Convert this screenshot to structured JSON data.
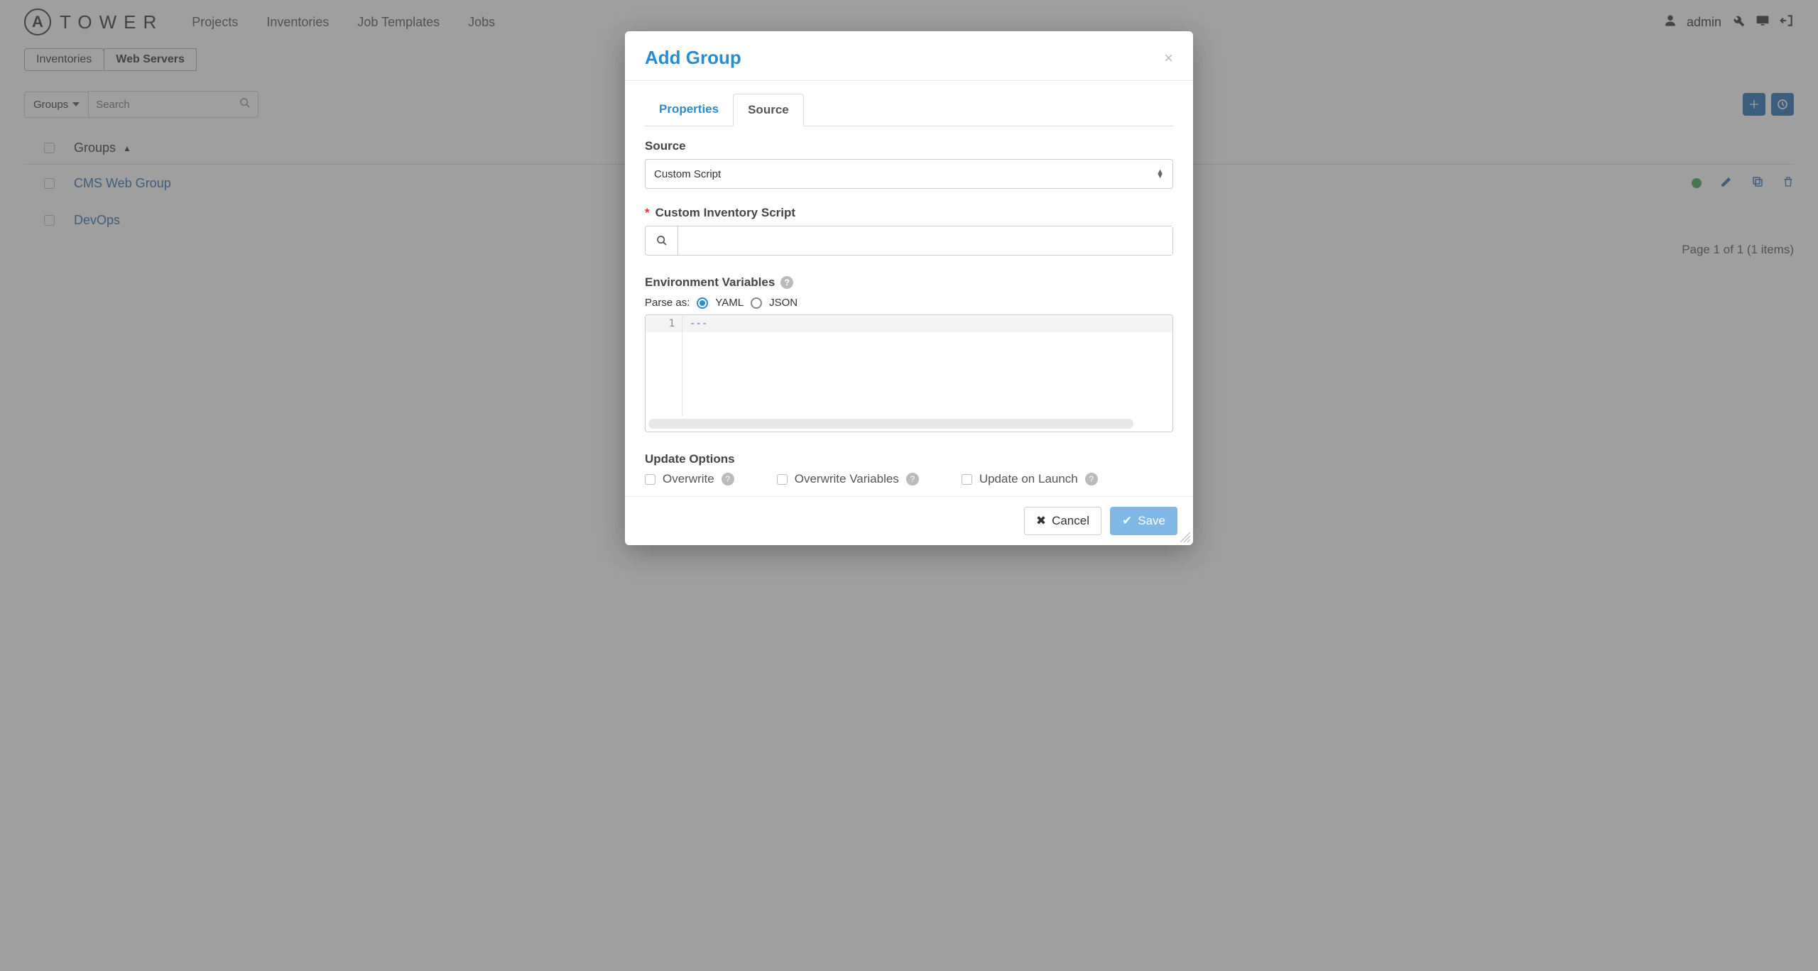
{
  "logo": {
    "badge": "A",
    "text": "TOWER"
  },
  "nav": {
    "projects": "Projects",
    "inventories": "Inventories",
    "job_templates": "Job Templates",
    "jobs": "Jobs"
  },
  "user": {
    "name": "admin"
  },
  "breadcrumb": {
    "a": "Inventories",
    "b": "Web Servers"
  },
  "toolbar": {
    "groups_btn": "Groups",
    "search_placeholder": "Search"
  },
  "table": {
    "header": "Groups",
    "rows": [
      {
        "name": "CMS Web Group"
      },
      {
        "name": "DevOps"
      }
    ],
    "pager": "Page 1 of 1 (1 items)"
  },
  "modal": {
    "title": "Add Group",
    "tabs": {
      "properties": "Properties",
      "source": "Source"
    },
    "source_label": "Source",
    "source_value": "Custom Script",
    "custom_script_label": "Custom Inventory Script",
    "env_label": "Environment Variables",
    "parse_as": "Parse as:",
    "parse_yaml": "YAML",
    "parse_json": "JSON",
    "code_line_no": "1",
    "code_line_text": "---",
    "update_options": "Update Options",
    "opt_overwrite": "Overwrite",
    "opt_overwrite_vars": "Overwrite Variables",
    "opt_update_launch": "Update on Launch",
    "cancel": "Cancel",
    "save": "Save"
  }
}
